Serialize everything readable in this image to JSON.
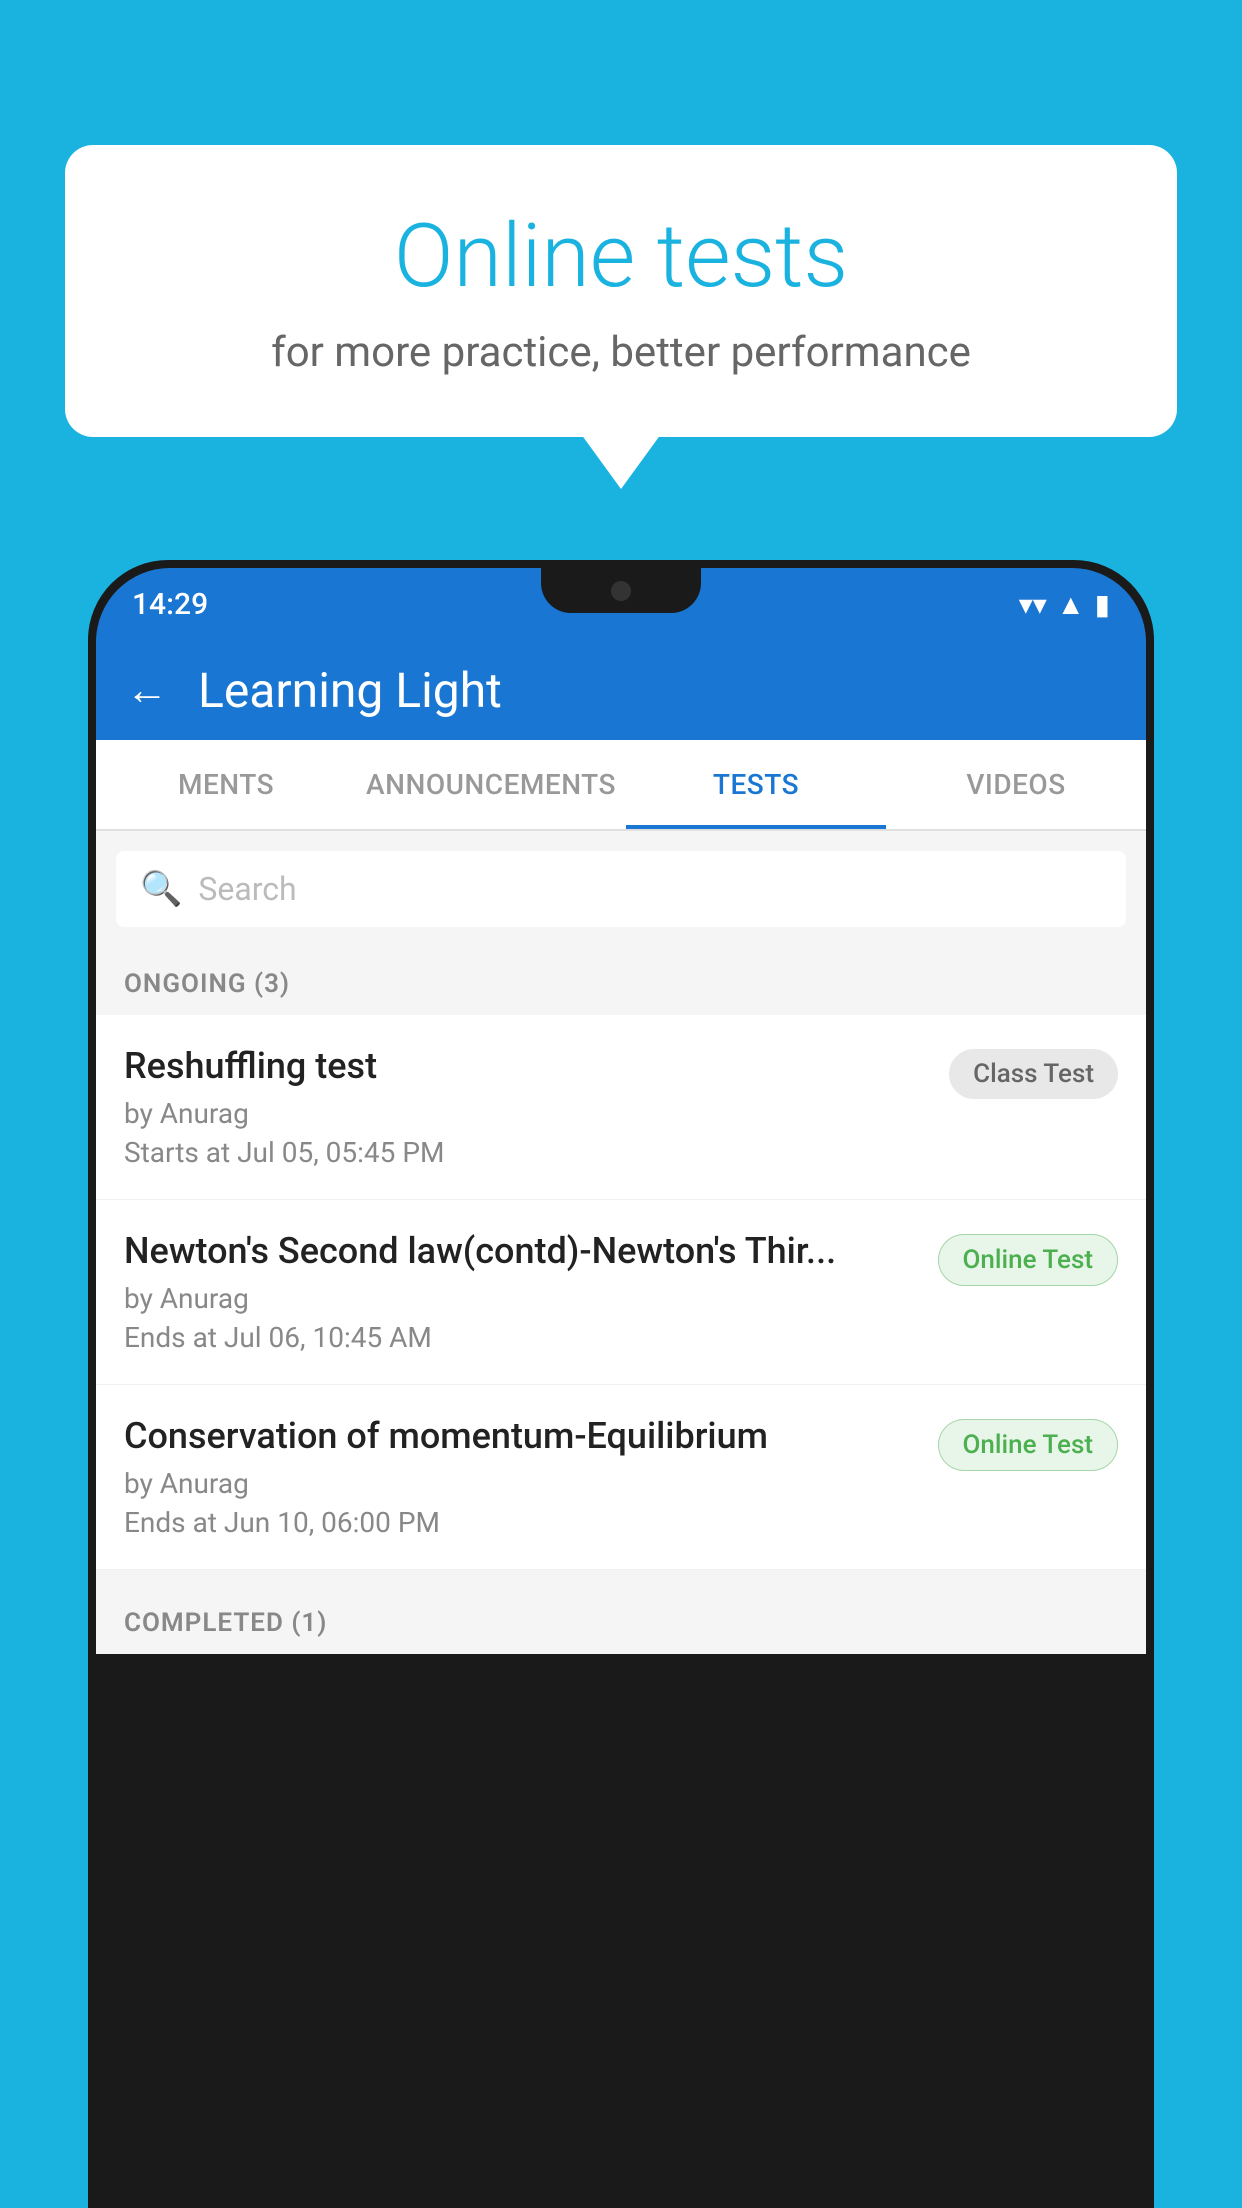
{
  "background": {
    "color": "#1ab3e0"
  },
  "speech_bubble": {
    "title": "Online tests",
    "subtitle": "for more practice, better performance"
  },
  "status_bar": {
    "time": "14:29",
    "wifi_icon": "▼",
    "signal_icon": "▲",
    "battery_icon": "▮"
  },
  "app_bar": {
    "back_label": "←",
    "title": "Learning Light"
  },
  "tabs": [
    {
      "label": "MENTS",
      "active": false
    },
    {
      "label": "ANNOUNCEMENTS",
      "active": false
    },
    {
      "label": "TESTS",
      "active": true
    },
    {
      "label": "VIDEOS",
      "active": false
    }
  ],
  "search": {
    "placeholder": "Search"
  },
  "ongoing_section": {
    "label": "ONGOING (3)"
  },
  "test_items": [
    {
      "name": "Reshuffling test",
      "author": "by Anurag",
      "date_label": "Starts at",
      "date": "Jul 05, 05:45 PM",
      "badge": "Class Test",
      "badge_type": "class"
    },
    {
      "name": "Newton's Second law(contd)-Newton's Thir...",
      "author": "by Anurag",
      "date_label": "Ends at",
      "date": "Jul 06, 10:45 AM",
      "badge": "Online Test",
      "badge_type": "online"
    },
    {
      "name": "Conservation of momentum-Equilibrium",
      "author": "by Anurag",
      "date_label": "Ends at",
      "date": "Jun 10, 06:00 PM",
      "badge": "Online Test",
      "badge_type": "online"
    }
  ],
  "completed_section": {
    "label": "COMPLETED (1)"
  }
}
